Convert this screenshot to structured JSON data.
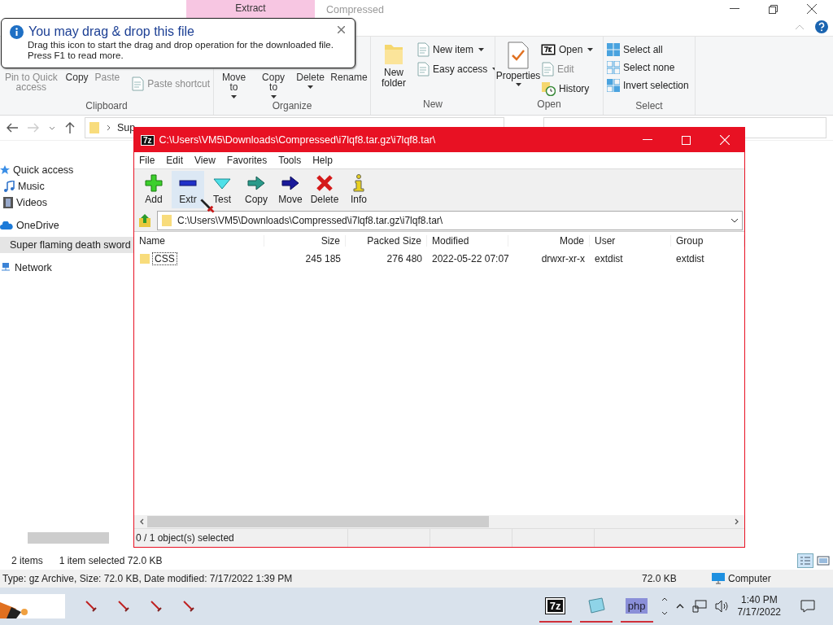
{
  "explorer": {
    "context_tab": {
      "label": "Extract",
      "selected": true
    },
    "title": "Compressed",
    "ribbon": [
      {
        "name": "Clipboard",
        "items": [
          {
            "label": "Pin to Quick access",
            "kind": "label",
            "disabled": true,
            "dropdown": false
          },
          {
            "label": "Copy",
            "kind": "label",
            "disabled": false,
            "dropdown": false
          },
          {
            "label": "Paste",
            "kind": "label",
            "disabled": true,
            "dropdown": false
          },
          {
            "label": "Paste shortcut",
            "kind": "small",
            "disabled": true,
            "dropdown": false
          }
        ]
      },
      {
        "name": "Organize",
        "items": [
          {
            "label": "Move to",
            "kind": "label",
            "disabled": false,
            "dropdown": true
          },
          {
            "label": "Copy to",
            "kind": "label",
            "disabled": false,
            "dropdown": true
          },
          {
            "label": "Delete",
            "kind": "label",
            "disabled": false,
            "dropdown": true
          },
          {
            "label": "Rename",
            "kind": "label",
            "disabled": false,
            "dropdown": false
          }
        ]
      },
      {
        "name": "New",
        "items": [
          {
            "label": "New folder",
            "kind": "large",
            "disabled": false,
            "dropdown": false
          },
          {
            "label": "New item",
            "kind": "small",
            "disabled": false,
            "dropdown": true
          },
          {
            "label": "Easy access",
            "kind": "small",
            "disabled": false,
            "dropdown": true
          }
        ]
      },
      {
        "name": "Open",
        "items": [
          {
            "label": "Properties",
            "kind": "large",
            "disabled": false,
            "dropdown": true
          },
          {
            "label": "Open",
            "kind": "small",
            "disabled": false,
            "dropdown": true
          },
          {
            "label": "Edit",
            "kind": "small",
            "disabled": true,
            "dropdown": false
          },
          {
            "label": "History",
            "kind": "small",
            "disabled": false,
            "dropdown": false
          }
        ]
      },
      {
        "name": "Select",
        "items": [
          {
            "label": "Select all",
            "kind": "small",
            "disabled": false,
            "dropdown": false
          },
          {
            "label": "Select none",
            "kind": "small",
            "disabled": false,
            "dropdown": false
          },
          {
            "label": "Invert selection",
            "kind": "small",
            "disabled": false,
            "dropdown": false
          }
        ]
      }
    ],
    "address": "Sup",
    "sidebar": [
      {
        "label": "Quick access",
        "selected": false
      },
      {
        "label": "Music",
        "selected": false
      },
      {
        "label": "Videos",
        "selected": false
      },
      {
        "label": "OneDrive",
        "selected": false
      },
      {
        "label": "Super flaming death sword",
        "selected": true
      },
      {
        "label": "Network",
        "selected": false
      }
    ],
    "status": [
      "2 items",
      "1 item selected  72.0 KB"
    ],
    "details": {
      "info": "Type: gz Archive, Size: 72.0 KB, Date modified: 7/17/2022 1:39 PM",
      "size": "72.0 KB",
      "zone": "Computer"
    }
  },
  "balloon": {
    "title": "You may drag & drop this file",
    "lines": [
      "Drag this icon to start the drag and drop operation for the downloaded file.",
      "Press F1 to read more."
    ]
  },
  "sevenzip": {
    "logo": "7z",
    "title": "C:\\Users\\VM5\\Downloads\\Compressed\\i7lqf8.tar.gz\\i7lqf8.tar\\",
    "menu": [
      "File",
      "Edit",
      "View",
      "Favorites",
      "Tools",
      "Help"
    ],
    "toolbar": [
      {
        "label": "Add",
        "highlighted": false
      },
      {
        "label": "Extr",
        "highlighted": true
      },
      {
        "label": "Test",
        "highlighted": false
      },
      {
        "label": "Copy",
        "highlighted": false
      },
      {
        "label": "Move",
        "highlighted": false
      },
      {
        "label": "Delete",
        "highlighted": false
      },
      {
        "label": "Info",
        "highlighted": false
      }
    ],
    "path": "C:\\Users\\VM5\\Downloads\\Compressed\\i7lqf8.tar.gz\\i7lqf8.tar\\",
    "columns": [
      "Name",
      "Size",
      "Packed Size",
      "Modified",
      "Mode",
      "User",
      "Group"
    ],
    "rows": [
      {
        "cells": [
          "CSS",
          "245 185",
          "276 480",
          "2022-05-22 07:07",
          "drwxr-xr-x",
          "extdist",
          "extdist"
        ],
        "focused": true
      }
    ],
    "status": "0 / 1 object(s) selected"
  },
  "taskbar": {
    "apps": [
      {
        "label": "7z",
        "running": true
      },
      {
        "running": true
      },
      {
        "label": "php",
        "running": true
      }
    ],
    "time": "1:40 PM",
    "date": "7/17/2022"
  }
}
